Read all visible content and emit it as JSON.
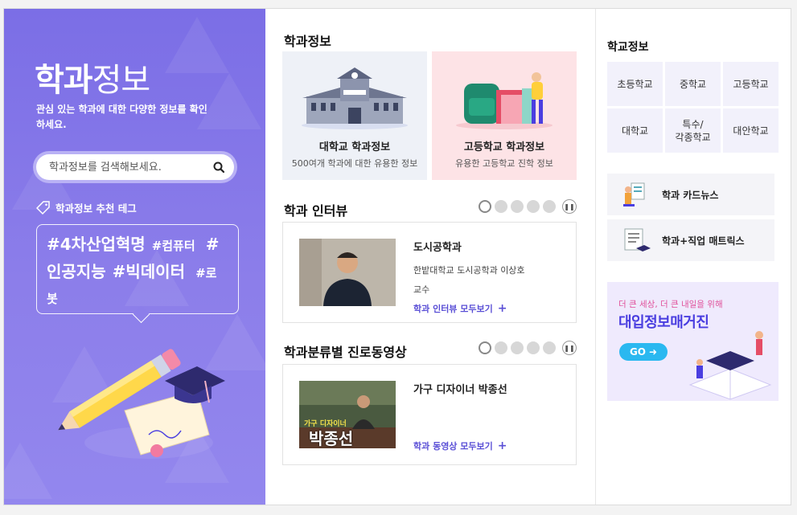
{
  "left": {
    "title_bold": "학과",
    "title_light": "정보",
    "description": "관심 있는 학과에 대한 다양한 정보를 확인하세요.",
    "search_placeholder": "학과정보를 검색해보세요.",
    "tag_title": "학과정보 추천 테그",
    "tags": [
      {
        "label": "#4차산업혁명",
        "size": "big"
      },
      {
        "label": "#컴퓨터",
        "size": "mid"
      },
      {
        "label": "#인공지능",
        "size": "big"
      },
      {
        "label": "#빅데이터",
        "size": "big"
      },
      {
        "label": "#로봇",
        "size": "mid"
      }
    ]
  },
  "dept_info": {
    "title": "학과정보",
    "cards": [
      {
        "title": "대학교 학과정보",
        "subtitle": "500여개 학과에 대한 유용한 정보",
        "bg": "#eef1f7"
      },
      {
        "title": "고등학교 학과정보",
        "subtitle": "유용한 고등학교 진학 정보",
        "bg": "#fde3e6"
      }
    ]
  },
  "interview": {
    "title": "학과 인터뷰",
    "dept": "도시공학과",
    "person": "한밭대학교 도시공학과 이상호",
    "role": "교수",
    "more": "학과 인터뷰 모두보기"
  },
  "video": {
    "title": "학과분류별 진로동영상",
    "name": "가구 디자이너 박종선",
    "overlay_small": "가구 디자이너",
    "overlay_big": "박종선",
    "more": "학과 동영상 모두보기"
  },
  "school_info": {
    "title": "학교정보",
    "items": [
      "초등학교",
      "중학교",
      "고등학교",
      "대학교",
      "특수/\n각종학교",
      "대안학교"
    ]
  },
  "side_links": [
    {
      "label": "학과 카드뉴스"
    },
    {
      "label": "학과+직업 매트릭스"
    }
  ],
  "banner": {
    "sub": "더 큰 세상, 더 큰 내일을 위해",
    "main": "대입정보매거진",
    "go": "GO"
  }
}
